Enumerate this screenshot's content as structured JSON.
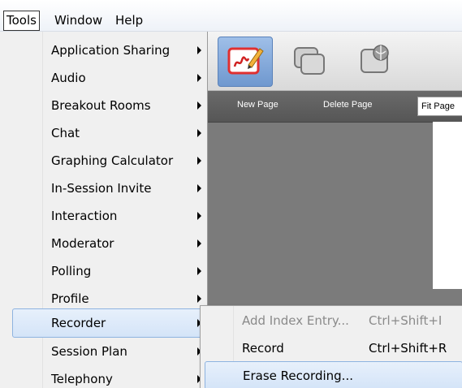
{
  "menubar": {
    "items": [
      "Tools",
      "Window",
      "Help"
    ]
  },
  "tools_menu": {
    "items": [
      {
        "label": "Application Sharing",
        "submenu": true
      },
      {
        "label": "Audio",
        "submenu": true
      },
      {
        "label": "Breakout Rooms",
        "submenu": true
      },
      {
        "label": "Chat",
        "submenu": true
      },
      {
        "label": "Graphing Calculator",
        "submenu": true
      },
      {
        "label": "In-Session Invite",
        "submenu": true
      },
      {
        "label": "Interaction",
        "submenu": true
      },
      {
        "label": "Moderator",
        "submenu": true
      },
      {
        "label": "Polling",
        "submenu": true
      },
      {
        "label": "Profile",
        "submenu": true
      },
      {
        "label": "Recorder",
        "submenu": true,
        "highlighted": true
      },
      {
        "label": "Session Plan",
        "submenu": true
      },
      {
        "label": "Telephony",
        "submenu": true
      }
    ]
  },
  "recorder_menu": {
    "items": [
      {
        "label": "Add Index Entry...",
        "shortcut": "Ctrl+Shift+I",
        "enabled": false
      },
      {
        "label": "Record",
        "shortcut": "Ctrl+Shift+R",
        "enabled": true
      },
      {
        "label": "Erase Recording...",
        "shortcut": "",
        "enabled": true,
        "highlighted": true
      }
    ]
  },
  "whiteboard_toolbar": {
    "new_page": "New Page",
    "delete_page": "Delete Page",
    "fit_page": "Fit Page"
  },
  "colors": {
    "highlight_bg": "#d4e4f8",
    "highlight_border": "#8eb3e0",
    "app_bg": "#7b7b7b",
    "toolbar_dark": "#5e5e5e"
  }
}
